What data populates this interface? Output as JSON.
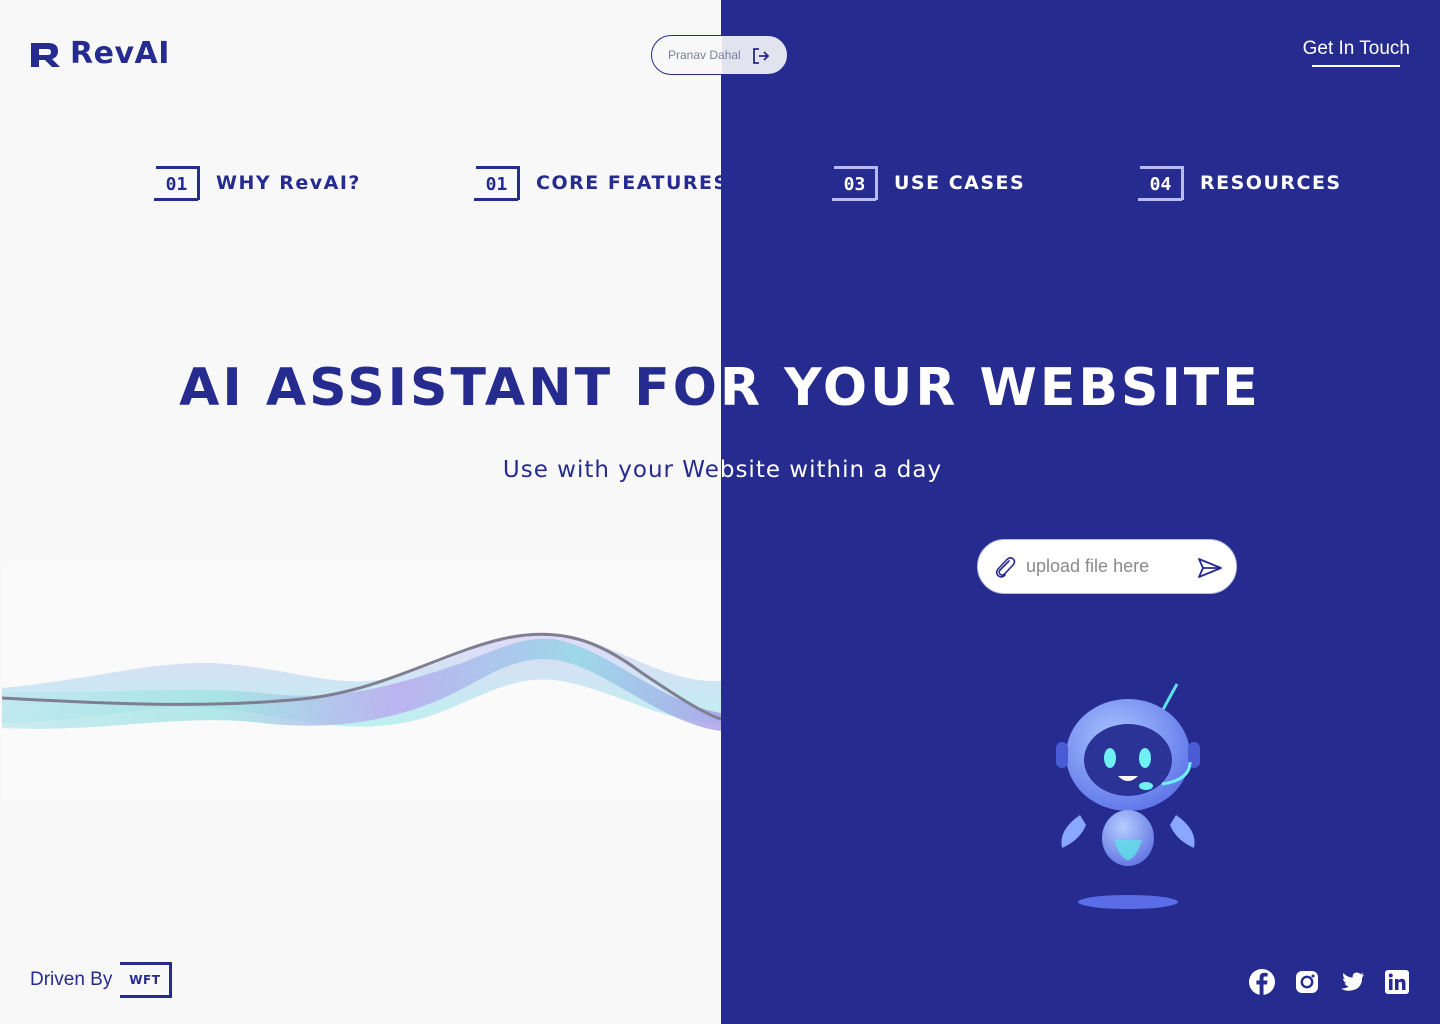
{
  "brand": {
    "name": "RevAI"
  },
  "user": {
    "name": "Pranav Dahal",
    "logout_icon": "logout-icon"
  },
  "header": {
    "contact_label": "Get In Touch"
  },
  "nav": [
    {
      "num": "01",
      "label": "WHY RevAI?"
    },
    {
      "num": "01",
      "label": "CORE FEATURES"
    },
    {
      "num": "03",
      "label": "USE CASES"
    },
    {
      "num": "04",
      "label": "RESOURCES"
    }
  ],
  "hero": {
    "title": "AI ASSISTANT FOR YOUR WEBSITE",
    "subtitle": "Use with your Website within a day"
  },
  "upload": {
    "placeholder": "upload file here",
    "icon": "paperclip-icon",
    "send_icon": "send-icon"
  },
  "footer": {
    "driven_label": "Driven By",
    "partner_badge": "WFT"
  },
  "social": [
    "facebook-icon",
    "instagram-icon",
    "twitter-icon",
    "linkedin-icon"
  ],
  "colors": {
    "primary": "#262b8f",
    "background": "#f8f8f8",
    "white": "#ffffff"
  }
}
